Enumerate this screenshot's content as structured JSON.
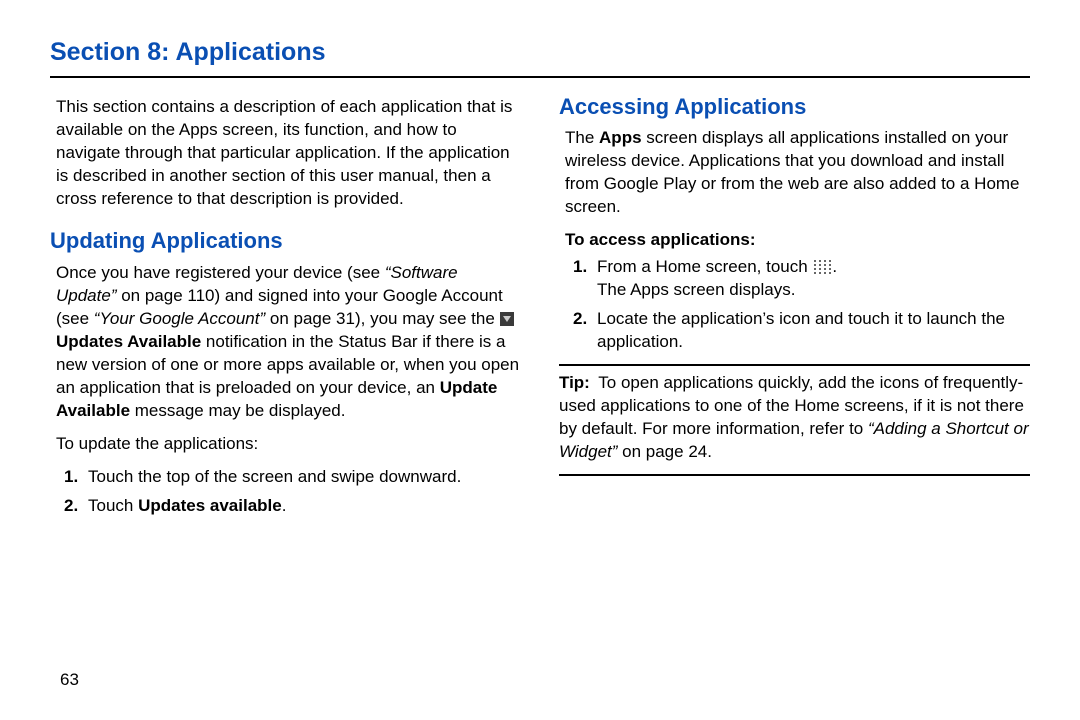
{
  "header": {
    "section_title": "Section 8: Applications"
  },
  "left": {
    "intro": "This section contains a description of each application that is available on the Apps screen, its function, and how to navigate through that particular application. If the application is described in another section of this user manual, then a cross reference to that description is provided.",
    "h2": "Updating Applications",
    "p1_a": "Once you have registered your device (see ",
    "p1_ref1": "“Software Update” ",
    "p1_b": "on page 110) and signed into your Google Account (see ",
    "p1_ref2": "“Your Google Account” ",
    "p1_c": "on page 31), you may see the ",
    "p1_bold1": " Updates Available",
    "p1_d": " notification in the Status Bar if there is a new version of one or more apps available or, when you open an application that is preloaded on your device, an ",
    "p1_bold2": "Update Available",
    "p1_e": " message may be displayed.",
    "to_update": "To update the applications:",
    "step1_num": "1.",
    "step1": "Touch the top of the screen and swipe downward.",
    "step2_num": "2.",
    "step2_a": "Touch ",
    "step2_bold": "Updates available",
    "step2_b": "."
  },
  "right": {
    "h2": "Accessing Applications",
    "p1_a": "The ",
    "p1_bold": "Apps",
    "p1_b": " screen displays all applications installed on your wireless device. Applications that you download and install from Google Play or from the web are also added to a Home screen.",
    "subsub": "To access applications:",
    "step1_num": "1.",
    "step1_a": "From a Home screen, touch ",
    "step1_b": ".",
    "step1_line2": "The Apps screen displays.",
    "step2_num": "2.",
    "step2": "Locate the application’s icon and touch it to launch the application.",
    "tip_label": "Tip:",
    "tip_a": " To open applications quickly, add the icons of frequently-used applications to one of the Home screens, if it is not there by default. For more information, refer to ",
    "tip_ref": "“Adding a Shortcut or Widget”",
    "tip_b": " on page 24."
  },
  "page_number": "63"
}
